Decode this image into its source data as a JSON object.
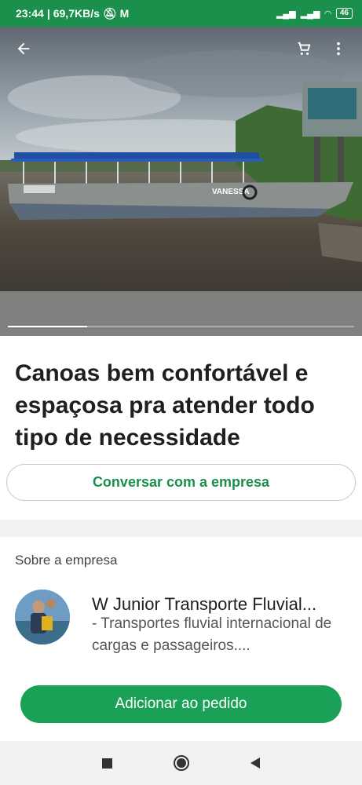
{
  "status_bar": {
    "time": "23:44",
    "network_speed": "69,7KB/s",
    "battery": "46"
  },
  "hero": {
    "back_icon": "arrow-left-icon",
    "cart_icon": "cart-icon",
    "menu_icon": "more-vert-icon",
    "boat_name": "VANESSA",
    "image_progress": 0.23
  },
  "listing": {
    "title": "Canoas bem confortável e espaçosa pra atender todo tipo de necessidade",
    "chat_button": "Conversar com a empresa"
  },
  "company": {
    "section_label": "Sobre a empresa",
    "name": "W Junior Transporte Fluvial...",
    "description": "- Transportes fluvial internacional de cargas e passageiros...."
  },
  "actions": {
    "add_to_order": "Adicionar ao pedido"
  },
  "colors": {
    "brand_green": "#1aa157",
    "status_green": "#1b8f4c"
  }
}
